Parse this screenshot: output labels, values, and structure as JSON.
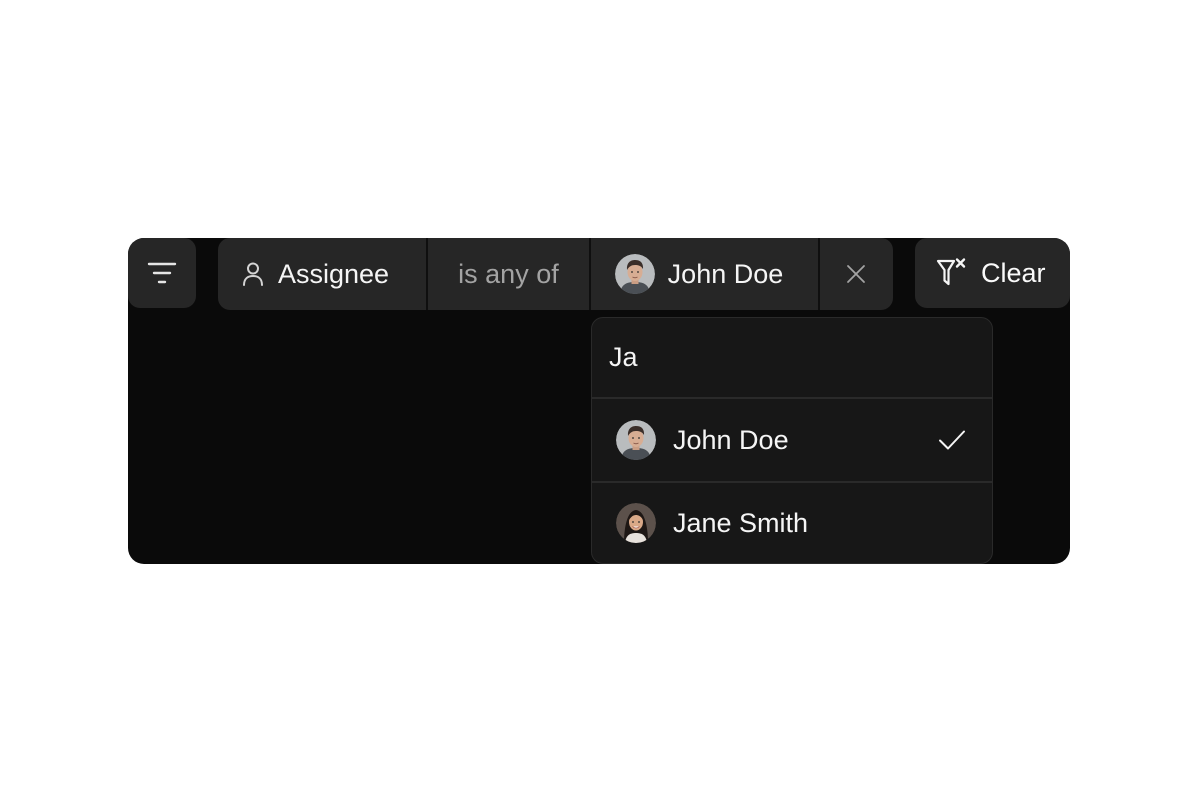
{
  "filter_bar": {
    "filter_icon": "filter-lines-icon",
    "chip": {
      "field_icon": "user-icon",
      "field_label": "Assignee",
      "operator_label": "is any of",
      "value_label": "John Doe",
      "remove_icon": "close-icon"
    },
    "clear_button": {
      "icon": "filter-x-icon",
      "label": "Clear"
    }
  },
  "dropdown": {
    "search_value": "Ja",
    "options": [
      {
        "label": "John Doe",
        "selected": true,
        "avatar": "avatar-john-doe"
      },
      {
        "label": "Jane Smith",
        "selected": false,
        "avatar": "avatar-jane-smith"
      }
    ],
    "check_icon": "check-icon"
  },
  "colors": {
    "panel_bg": "#0a0a0a",
    "control_bg": "#262626",
    "dropdown_bg": "#171717",
    "text_primary": "#f5f5f5",
    "text_muted": "#a3a3a3"
  }
}
